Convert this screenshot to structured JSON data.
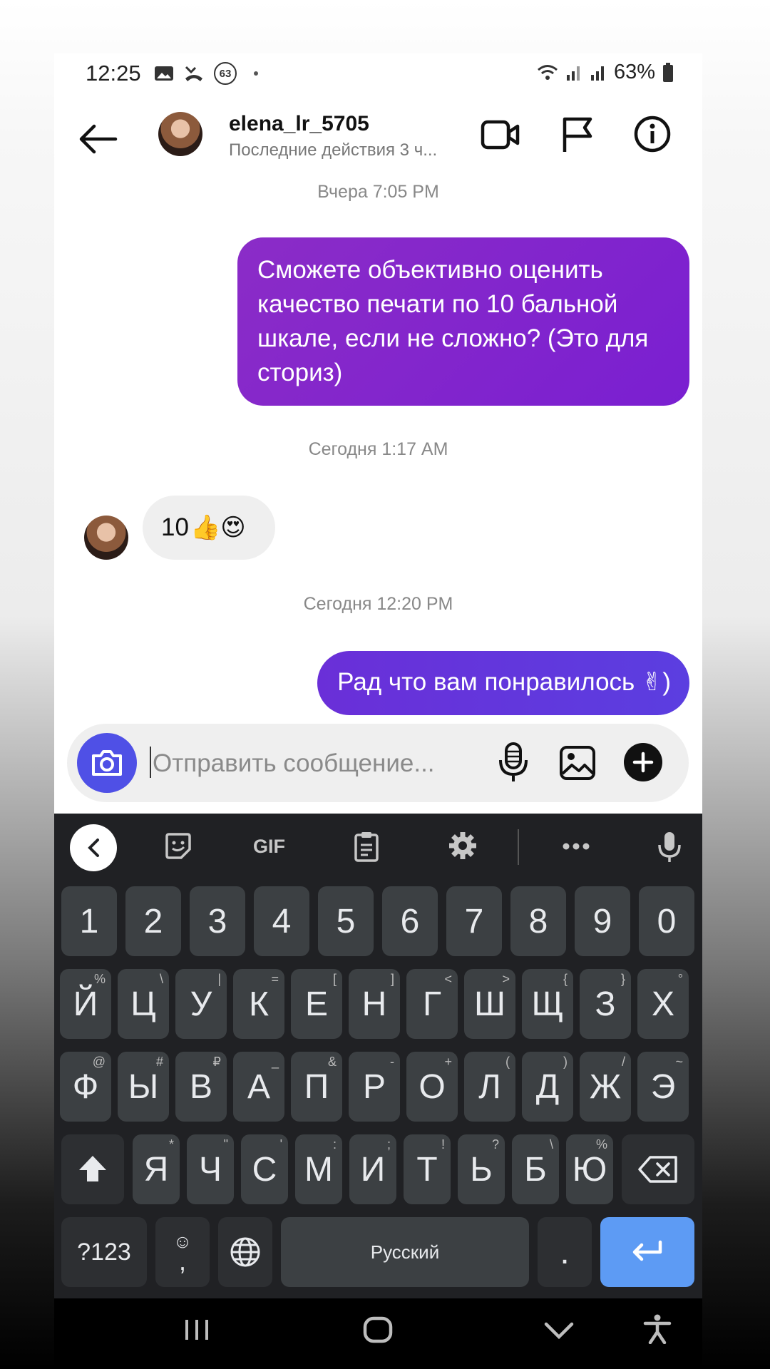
{
  "status_bar": {
    "time": "12:25",
    "badge": "63",
    "battery": "63%"
  },
  "header": {
    "username": "elena_lr_5705",
    "activity": "Последние действия 3 ч..."
  },
  "messages": {
    "ts1": "Вчера 7:05 PM",
    "msg1": "Сможете объективно оценить качество печати по 10 бальной шкале, если не сложно? (Это для сториз)",
    "ts2": "Сегодня 1:17 AM",
    "msg2": "10",
    "msg2_emoji": "👍😍",
    "ts3": "Сегодня 12:20 PM",
    "msg3": "Рад что вам понравилось ✌)"
  },
  "composer": {
    "placeholder": "Отправить сообщение..."
  },
  "keyboard": {
    "toolbar_gif": "GIF",
    "numbers": [
      "1",
      "2",
      "3",
      "4",
      "5",
      "6",
      "7",
      "8",
      "9",
      "0"
    ],
    "row1": [
      {
        "k": "Й",
        "s": "%"
      },
      {
        "k": "Ц",
        "s": "\\"
      },
      {
        "k": "У",
        "s": "|"
      },
      {
        "k": "К",
        "s": "="
      },
      {
        "k": "Е",
        "s": "["
      },
      {
        "k": "Н",
        "s": "]"
      },
      {
        "k": "Г",
        "s": "<"
      },
      {
        "k": "Ш",
        "s": ">"
      },
      {
        "k": "Щ",
        "s": "{"
      },
      {
        "k": "З",
        "s": "}"
      },
      {
        "k": "Х",
        "s": "°"
      }
    ],
    "row2": [
      {
        "k": "Ф",
        "s": "@"
      },
      {
        "k": "Ы",
        "s": "#"
      },
      {
        "k": "В",
        "s": "₽"
      },
      {
        "k": "А",
        "s": "_"
      },
      {
        "k": "П",
        "s": "&"
      },
      {
        "k": "Р",
        "s": "-"
      },
      {
        "k": "О",
        "s": "+"
      },
      {
        "k": "Л",
        "s": "("
      },
      {
        "k": "Д",
        "s": ")"
      },
      {
        "k": "Ж",
        "s": "/"
      },
      {
        "k": "Э",
        "s": "~"
      }
    ],
    "row3": [
      {
        "k": "Я",
        "s": "*"
      },
      {
        "k": "Ч",
        "s": "\""
      },
      {
        "k": "С",
        "s": "'"
      },
      {
        "k": "М",
        "s": ":"
      },
      {
        "k": "И",
        "s": ";"
      },
      {
        "k": "Т",
        "s": "!"
      },
      {
        "k": "Ь",
        "s": "?"
      },
      {
        "k": "Б",
        "s": "\\"
      },
      {
        "k": "Ю",
        "s": "%"
      }
    ],
    "symbols_key": "?123",
    "comma_key": ",",
    "emoji_key": "☺",
    "space_label": "Русский",
    "period_key": "."
  },
  "colors": {
    "outgoing_bubble_1": "#8b2cc7",
    "outgoing_bubble_2": "#5b3ee0",
    "camera_button": "#4f50e6",
    "enter_key": "#5d9bf4",
    "keyboard_bg": "#202124"
  }
}
